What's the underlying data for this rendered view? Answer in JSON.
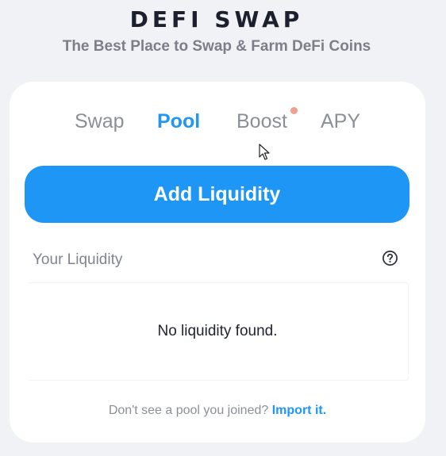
{
  "header": {
    "title": "DEFI SWAP",
    "tagline": "The Best Place to Swap & Farm DeFi Coins"
  },
  "tabs": [
    {
      "label": "Swap",
      "active": false
    },
    {
      "label": "Pool",
      "active": true
    },
    {
      "label": "Boost",
      "active": false,
      "badge": true
    },
    {
      "label": "APY",
      "active": false
    }
  ],
  "pool": {
    "add_liquidity_label": "Add Liquidity",
    "your_liquidity_label": "Your Liquidity",
    "empty_message": "No liquidity found.",
    "footer_text": "Don't see a pool you joined?",
    "import_link": "Import it."
  },
  "icons": {
    "help": "question-circle-icon",
    "cursor": "mouse-pointer-icon",
    "badge": "notification-dot-icon"
  },
  "colors": {
    "accent": "#1e96f5",
    "badge": "#f0a090",
    "page_bg": "#f1f2f5",
    "card_bg": "#ffffff"
  }
}
